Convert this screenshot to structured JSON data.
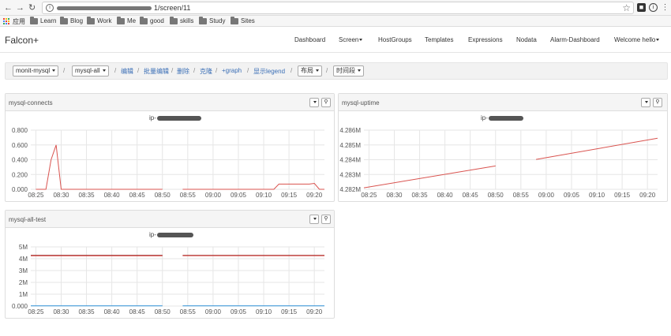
{
  "browser": {
    "url_suffix": "1/screen/11",
    "bookmarks": [
      {
        "label": "应用",
        "icon": "apps-grid-icon"
      },
      {
        "label": "Learn",
        "icon": "folder-icon"
      },
      {
        "label": "Blog",
        "icon": "folder-icon"
      },
      {
        "label": "Work",
        "icon": "folder-icon"
      },
      {
        "label": "Me",
        "icon": "folder-icon"
      },
      {
        "label": "good",
        "icon": "folder-icon"
      },
      {
        "label": "skills",
        "icon": "folder-icon"
      },
      {
        "label": "Study",
        "icon": "folder-icon"
      },
      {
        "label": "Sites",
        "icon": "folder-icon"
      }
    ]
  },
  "navbar": {
    "brand": "Falcon+",
    "items": [
      "Dashboard",
      "Screen",
      "HostGroups",
      "Templates",
      "Expressions",
      "Nodata",
      "Alarm-Dashboard",
      "Welcome hello"
    ]
  },
  "toolbar": {
    "endpoint_select": "monit-mysql",
    "counter_select": "mysql-all",
    "edit": "编辑",
    "batch_edit": "批量编辑",
    "delete": "删除",
    "clone": "克隆",
    "add_graph": "+graph",
    "show_legend": "显示legend",
    "layout_select": "布局",
    "time_select": "时间段"
  },
  "colors": {
    "line_red": "#d9534f",
    "line_dark_red": "#8b1c1c",
    "line_blue": "#2f8fd6",
    "link": "#3b6fb6"
  },
  "chart_data": [
    {
      "type": "line",
      "title": "mysql-connects",
      "subtitle": "ip-",
      "x_ticks": [
        "08:25",
        "08:30",
        "08:35",
        "08:40",
        "08:45",
        "08:50",
        "08:55",
        "09:00",
        "09:05",
        "09:10",
        "09:15",
        "09:20"
      ],
      "y_ticks": [
        "0.000",
        "0.200",
        "0.400",
        "0.600",
        "0.800"
      ],
      "ylim": [
        0,
        0.8
      ],
      "series": [
        {
          "color": "#d9534f",
          "segments": [
            [
              [
                "08:25",
                0
              ],
              [
                "08:27",
                0
              ],
              [
                "08:28",
                0.4
              ],
              [
                "08:29",
                0.6
              ],
              [
                "08:30",
                0
              ],
              [
                "08:50",
                0
              ]
            ],
            [
              [
                "08:54",
                0
              ],
              [
                "09:12",
                0
              ],
              [
                "09:13",
                0.07
              ],
              [
                "09:19",
                0.07
              ],
              [
                "09:20",
                0.08
              ],
              [
                "09:21",
                0
              ],
              [
                "09:22",
                0
              ]
            ]
          ]
        }
      ]
    },
    {
      "type": "line",
      "title": "mysql-uptime",
      "subtitle": "ip-",
      "x_ticks": [
        "08:25",
        "08:30",
        "08:35",
        "08:40",
        "08:45",
        "08:50",
        "08:55",
        "09:00",
        "09:05",
        "09:10",
        "09:15",
        "09:20"
      ],
      "y_ticks": [
        "4.282M",
        "4.283M",
        "4.284M",
        "4.285M",
        "4.286M"
      ],
      "ylim": [
        4282000,
        4286000
      ],
      "series": [
        {
          "color": "#d9534f",
          "segments": [
            [
              [
                "08:24",
                4282100
              ],
              [
                "08:50",
                4283580
              ]
            ],
            [
              [
                "08:58",
                4284020
              ],
              [
                "09:22",
                4285450
              ]
            ]
          ]
        }
      ]
    },
    {
      "type": "line",
      "title": "mysql-all-test",
      "subtitle": "ip-",
      "x_ticks": [
        "08:25",
        "08:30",
        "08:35",
        "08:40",
        "08:45",
        "08:50",
        "08:55",
        "09:00",
        "09:05",
        "09:10",
        "09:15",
        "09:20"
      ],
      "y_ticks": [
        "0.000",
        "1M",
        "2M",
        "3M",
        "4M",
        "5M"
      ],
      "ylim": [
        0,
        5000000
      ],
      "series": [
        {
          "color": "#8b1c1c",
          "segments": [
            [
              [
                "08:24",
                4280000
              ],
              [
                "08:50",
                4283000
              ]
            ],
            [
              [
                "08:54",
                4284000
              ],
              [
                "09:22",
                4285500
              ]
            ]
          ]
        },
        {
          "color": "#d9534f",
          "segments": [
            [
              [
                "08:24",
                4240000
              ],
              [
                "08:50",
                4243000
              ]
            ],
            [
              [
                "08:54",
                4244000
              ],
              [
                "09:22",
                4245500
              ]
            ]
          ]
        },
        {
          "color": "#2f8fd6",
          "segments": [
            [
              [
                "08:24",
                20000
              ],
              [
                "08:50",
                20000
              ]
            ],
            [
              [
                "08:54",
                20000
              ],
              [
                "09:22",
                20000
              ]
            ]
          ]
        }
      ]
    }
  ]
}
